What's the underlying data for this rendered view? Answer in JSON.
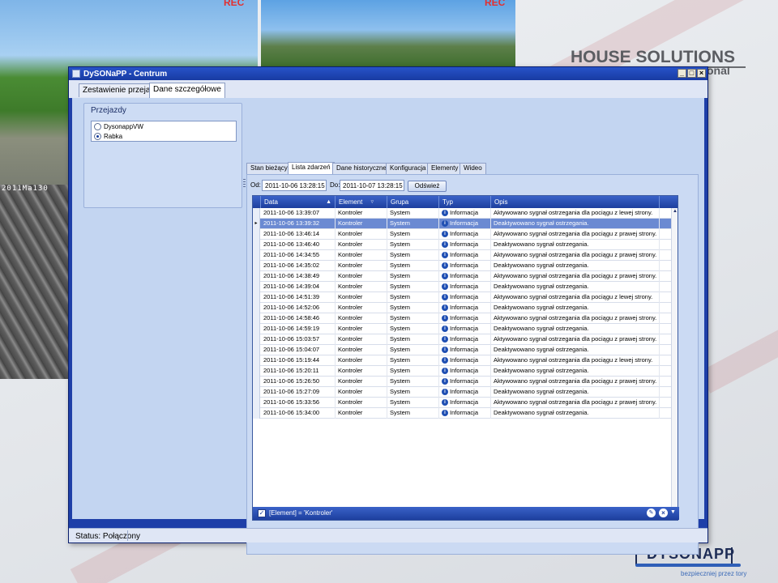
{
  "background": {
    "cam1_label": "REC",
    "cam2_label": "REC",
    "cam3_stamp": "2011Ma130",
    "house_logo": {
      "main": "HOUSE SOLUTIONS",
      "sub": "onal"
    },
    "dyso_logo": {
      "name": "DYSONAPP",
      "slogan": "bezpieczniej przez tory"
    }
  },
  "window": {
    "title": "DySONaPP - Centrum",
    "controls": [
      "_",
      "□",
      "×"
    ]
  },
  "main_tabs": [
    {
      "label": "Zestawienie przejazdów",
      "active": false
    },
    {
      "label": "Dane szczegółowe",
      "active": true
    }
  ],
  "left_group": {
    "title": "Przejazdy",
    "items": [
      {
        "label": "DysonappVW",
        "checked": false
      },
      {
        "label": "Rabka",
        "checked": true
      }
    ]
  },
  "detail_tabs": [
    {
      "label": "Stan bieżący",
      "active": false
    },
    {
      "label": "Lista zdarzeń",
      "active": true
    },
    {
      "label": "Dane historyczne",
      "active": false
    },
    {
      "label": "Konfiguracja",
      "active": false
    },
    {
      "label": "Elementy",
      "active": false
    },
    {
      "label": "Wideo",
      "active": false
    }
  ],
  "filter": {
    "from_label": "Od:",
    "from_value": "2011-10-06 13:28:15",
    "to_label": "Do:",
    "to_value": "2011-10-07 13:28:15",
    "refresh_label": "Odśwież"
  },
  "grid": {
    "columns": [
      "Data",
      "Element",
      "Grupa",
      "Typ",
      "Opis"
    ],
    "sort_column": "Data",
    "rows": [
      [
        "2011-10-06 13:39:07",
        "Kontroler",
        "System",
        "Informacja",
        "Aktywowano sygnał ostrzegania dla pociągu z lewej strony."
      ],
      [
        "2011-10-06 13:39:32",
        "Kontroler",
        "System",
        "Informacja",
        "Deaktywowano sygnał ostrzegania."
      ],
      [
        "2011-10-06 13:46:14",
        "Kontroler",
        "System",
        "Informacja",
        "Aktywowano sygnał ostrzegania dla pociągu z prawej strony."
      ],
      [
        "2011-10-06 13:46:40",
        "Kontroler",
        "System",
        "Informacja",
        "Deaktywowano sygnał ostrzegania."
      ],
      [
        "2011-10-06 14:34:55",
        "Kontroler",
        "System",
        "Informacja",
        "Aktywowano sygnał ostrzegania dla pociągu z prawej strony."
      ],
      [
        "2011-10-06 14:35:02",
        "Kontroler",
        "System",
        "Informacja",
        "Deaktywowano sygnał ostrzegania."
      ],
      [
        "2011-10-06 14:38:49",
        "Kontroler",
        "System",
        "Informacja",
        "Aktywowano sygnał ostrzegania dla pociągu z prawej strony."
      ],
      [
        "2011-10-06 14:39:04",
        "Kontroler",
        "System",
        "Informacja",
        "Deaktywowano sygnał ostrzegania."
      ],
      [
        "2011-10-06 14:51:39",
        "Kontroler",
        "System",
        "Informacja",
        "Aktywowano sygnał ostrzegania dla pociągu z lewej strony."
      ],
      [
        "2011-10-06 14:52:06",
        "Kontroler",
        "System",
        "Informacja",
        "Deaktywowano sygnał ostrzegania."
      ],
      [
        "2011-10-06 14:58:46",
        "Kontroler",
        "System",
        "Informacja",
        "Aktywowano sygnał ostrzegania dla pociągu z prawej strony."
      ],
      [
        "2011-10-06 14:59:19",
        "Kontroler",
        "System",
        "Informacja",
        "Deaktywowano sygnał ostrzegania."
      ],
      [
        "2011-10-06 15:03:57",
        "Kontroler",
        "System",
        "Informacja",
        "Aktywowano sygnał ostrzegania dla pociągu z prawej strony."
      ],
      [
        "2011-10-06 15:04:07",
        "Kontroler",
        "System",
        "Informacja",
        "Deaktywowano sygnał ostrzegania."
      ],
      [
        "2011-10-06 15:19:44",
        "Kontroler",
        "System",
        "Informacja",
        "Aktywowano sygnał ostrzegania dla pociągu z lewej strony."
      ],
      [
        "2011-10-06 15:20:11",
        "Kontroler",
        "System",
        "Informacja",
        "Deaktywowano sygnał ostrzegania."
      ],
      [
        "2011-10-06 15:26:50",
        "Kontroler",
        "System",
        "Informacja",
        "Aktywowano sygnał ostrzegania dla pociągu z prawej strony."
      ],
      [
        "2011-10-06 15:27:09",
        "Kontroler",
        "System",
        "Informacja",
        "Deaktywowano sygnał ostrzegania."
      ],
      [
        "2011-10-06 15:33:56",
        "Kontroler",
        "System",
        "Informacja",
        "Aktywowano sygnał ostrzegania dla pociągu z prawej strony."
      ],
      [
        "2011-10-06 15:34:00",
        "Kontroler",
        "System",
        "Informacja",
        "Deaktywowano sygnał ostrzegania."
      ]
    ],
    "selected_row": 1,
    "type_icon": "info-icon",
    "filter_text": "[Element] = 'Kontroler'",
    "filter_checked": true
  },
  "status": {
    "text": "Status: Połączony"
  },
  "colors": {
    "window_frame": "#1e3fa8",
    "grid_header": "#2a4fb4",
    "selected_row": "#6b8ad2",
    "panel": "#c3d5f1"
  }
}
